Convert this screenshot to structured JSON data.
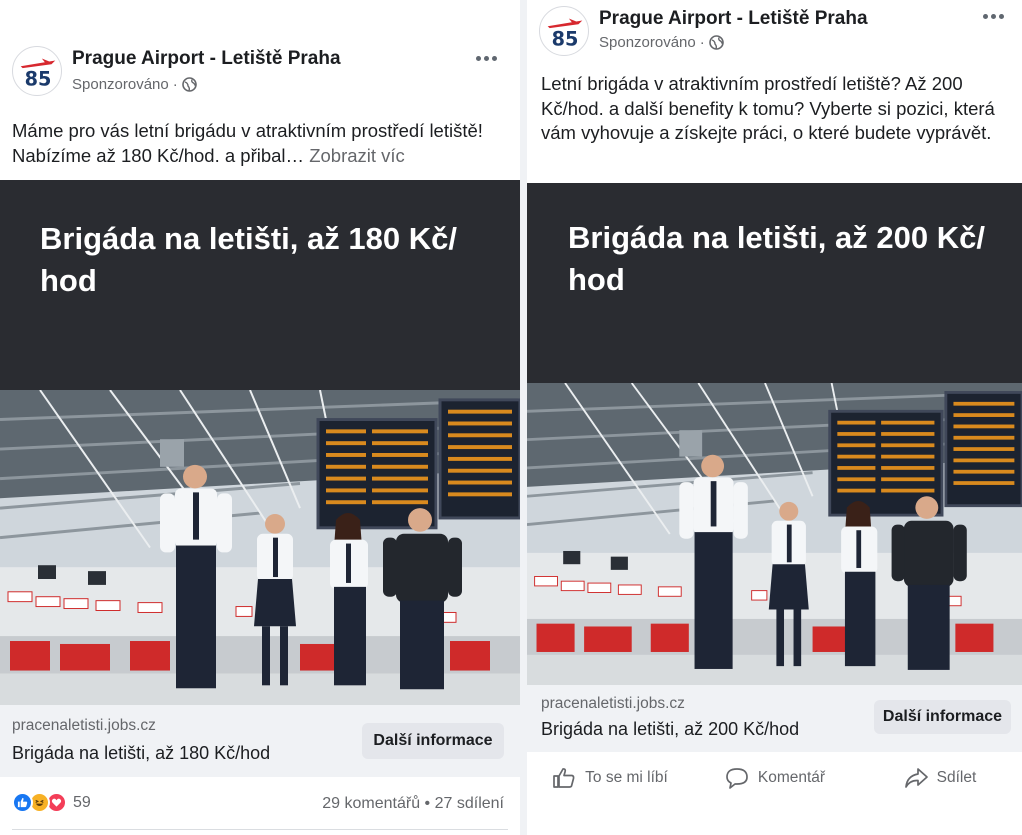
{
  "left_post": {
    "page_name": "Prague Airport - Letiště Praha",
    "sponsored": "Sponzorováno",
    "separator": "·",
    "post_text": "Máme pro vás letní brigádu v atraktivním prostředí letiště! Nabízíme až 180 Kč/hod. a přibal…",
    "see_more": "Zobrazit víc",
    "hero_title": "Brigáda na letišti, až 180 Kč/ hod",
    "link_domain": "pracenaletisti.jobs.cz",
    "link_title": "Brigáda na letišti, až 180 Kč/hod",
    "cta_label": "Další informace",
    "reaction_count": "59",
    "comments": "29 komentářů",
    "shares": "27 sdílení",
    "stats_separator": "•"
  },
  "right_post": {
    "page_name": "Prague Airport - Letiště Praha",
    "sponsored": "Sponzorováno",
    "separator": "·",
    "post_text": "Letní brigáda v atraktivním prostředí letiště? Až 200 Kč/hod. a další benefity k tomu? Vyberte si pozici, která vám vyhovuje a získejte práci, o které budete vyprávět.",
    "hero_title": "Brigáda na letišti, až 200 Kč/ hod",
    "link_domain": "pracenaletisti.jobs.cz",
    "link_title": "Brigáda na letišti, až 200 Kč/hod",
    "cta_label": "Další informace",
    "actions": {
      "like": "To se mi líbí",
      "comment": "Komentář",
      "share": "Sdílet"
    }
  },
  "logo_text": "85",
  "colors": {
    "hero_band": "#2a2c31",
    "link_bar": "#f0f2f5",
    "cta_bg": "#e4e6eb",
    "secondary_text": "#65676b",
    "like_blue": "#1877f2",
    "love_red": "#f33e58",
    "haha_yellow": "#f7b125",
    "logo_red": "#d7282f",
    "logo_navy": "#1b3a6b"
  },
  "reaction_icons": [
    "like-icon",
    "haha-icon",
    "love-icon"
  ]
}
